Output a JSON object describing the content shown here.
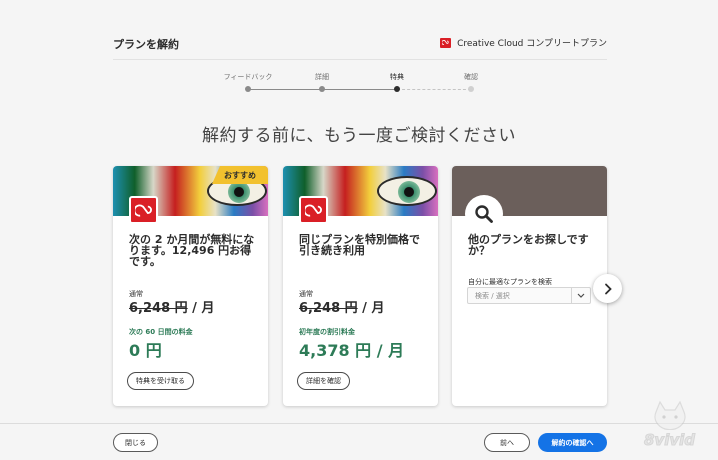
{
  "header": {
    "title": "プランを解約",
    "product": "Creative Cloud コンプリートプラン"
  },
  "steps": [
    {
      "label": "フィードバック"
    },
    {
      "label": "詳細"
    },
    {
      "label": "特典"
    },
    {
      "label": "確認"
    }
  ],
  "headline": "解約する前に、もう一度ご検討ください",
  "cards": [
    {
      "badge": "おすすめ",
      "title": "次の 2 か月間が無料になります。12,496 円お得です。",
      "regular_label": "通常",
      "regular_price": "6,248 円",
      "regular_unit": " / 月",
      "offer_label": "次の 60 日間の料金",
      "offer_price": "0 円",
      "button": "特典を受け取る"
    },
    {
      "title": "同じプランを特別価格で引き続き利用",
      "regular_label": "通常",
      "regular_price": "6,248 円",
      "regular_unit": " / 月",
      "offer_label": "初年度の割引料金",
      "offer_price": "4,378 円 / 月",
      "button": "詳細を確認"
    },
    {
      "title": "他のプランをお探しですか？",
      "field_label": "自分に最適なプランを検索",
      "select_placeholder": "検索 / 選択"
    }
  ],
  "footer": {
    "close": "閉じる",
    "back": "前へ",
    "confirm": "解約の確認へ"
  },
  "watermark": "8vivid",
  "colors": {
    "accent": "#1473e6",
    "offer": "#2d7b57",
    "badge": "#f2c12e",
    "brand": "#da1f26"
  }
}
